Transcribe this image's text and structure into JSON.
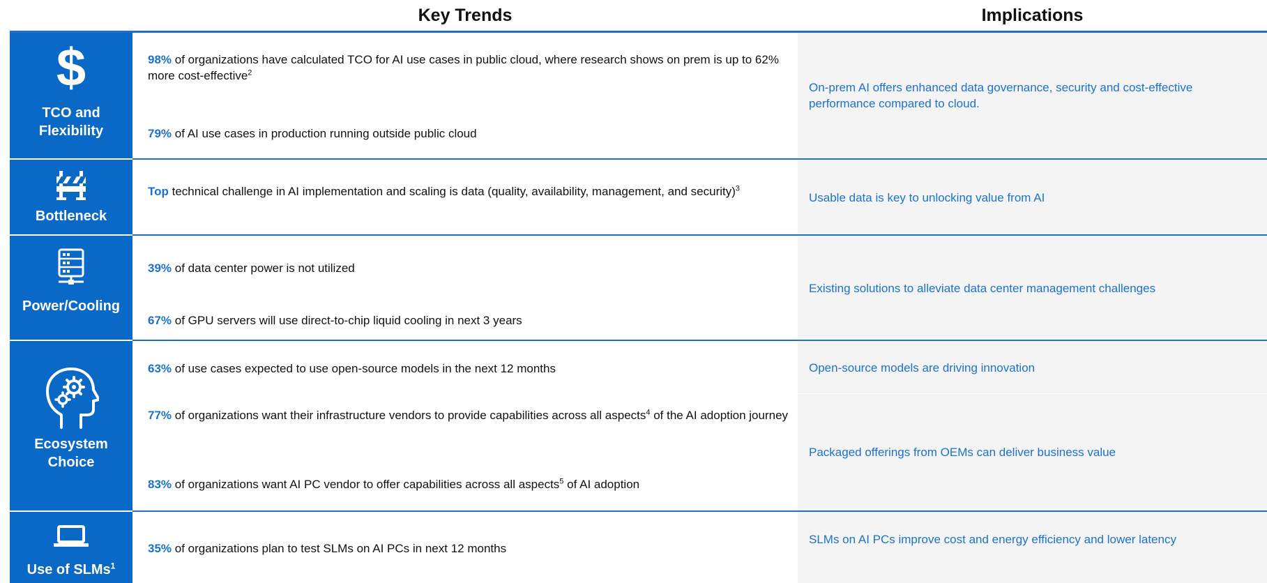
{
  "header": {
    "trends": "Key Trends",
    "implications": "Implications"
  },
  "colors": {
    "sidebar": "#0a68c6",
    "accent": "#1c72c9",
    "rule": "#1f6fc4",
    "implication_bg": "#f4f4f4"
  },
  "sections": [
    {
      "icon": "dollar-icon",
      "label_lines": [
        "TCO and",
        "Flexibility"
      ],
      "trends": [
        {
          "pct": "98%",
          "text": " of organizations have calculated TCO for AI use cases in public cloud, where research shows on prem is up to 62% more cost-effective",
          "sup": "2"
        },
        {
          "pct": "79%",
          "text": " of AI use cases in production running outside public cloud"
        }
      ],
      "implications": [
        "On-prem AI offers enhanced data governance, security and cost-effective performance compared to cloud."
      ]
    },
    {
      "icon": "roadblock-icon",
      "label_lines": [
        "Bottleneck"
      ],
      "trends": [
        {
          "pct": "Top",
          "text": " technical challenge in AI implementation and scaling is data (quality, availability, management, and security)",
          "sup": "3"
        }
      ],
      "implications": [
        "Usable data is key to unlocking value from AI"
      ]
    },
    {
      "icon": "server-icon",
      "label_lines": [
        "Power/Cooling"
      ],
      "trends": [
        {
          "pct": "39%",
          "text": " of data center power is not utilized"
        },
        {
          "pct": "67%",
          "text": " of GPU servers will use direct-to-chip liquid cooling in next 3 years"
        }
      ],
      "implications": [
        "Existing solutions to alleviate data center management challenges"
      ]
    },
    {
      "icon": "head-gears-icon",
      "label_lines": [
        "Ecosystem",
        "Choice"
      ],
      "trends": [
        {
          "pct": "63%",
          "text": " of use cases expected to use open-source models in the next 12 months"
        },
        {
          "pct": "77%",
          "text": " of organizations want their infrastructure vendors to provide capabilities across all aspects",
          "sup": "4",
          "text2": " of the AI adoption journey"
        },
        {
          "pct": "83%",
          "text": " of organizations want AI PC vendor to offer capabilities across all aspects",
          "sup": "5",
          "text2": " of AI adoption"
        }
      ],
      "implications": [
        "Open-source models are driving innovation",
        "Packaged offerings from OEMs can deliver business value"
      ]
    },
    {
      "icon": "laptop-icon",
      "label_lines": [
        "Use of SLMs"
      ],
      "label_sup": "1",
      "trends": [
        {
          "pct": "35%",
          "text": " of organizations plan to test SLMs on AI PCs in next 12 months"
        }
      ],
      "implications": [
        "SLMs on AI PCs improve cost and energy efficiency and lower latency"
      ]
    }
  ]
}
